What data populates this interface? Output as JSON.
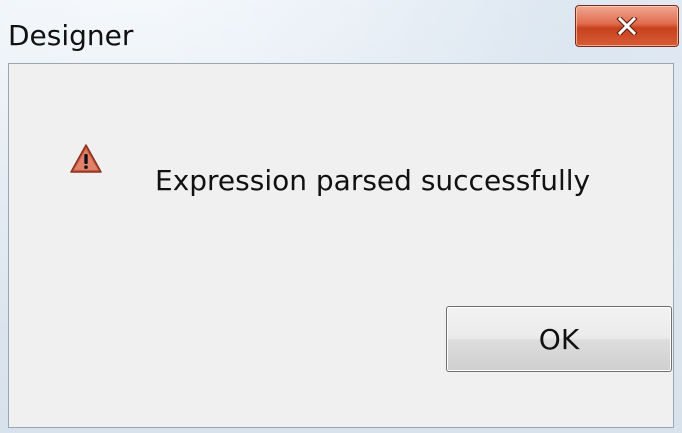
{
  "window": {
    "title": "Designer"
  },
  "titlebar": {
    "close_icon": "close-icon"
  },
  "dialog": {
    "icon": "warning-icon",
    "message": "Expression parsed successfully",
    "ok_label": "OK"
  },
  "colors": {
    "close_button": "#d65b35",
    "client_background": "#f0f0f0",
    "warning_icon": "#c9553c"
  }
}
